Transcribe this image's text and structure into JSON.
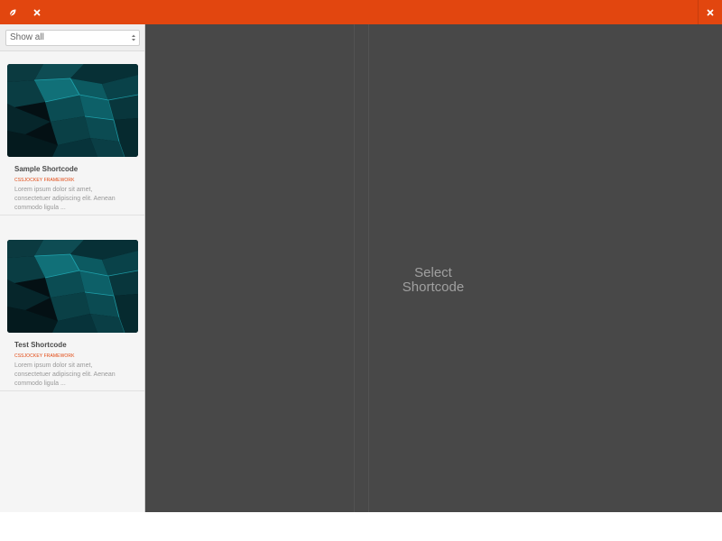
{
  "app": {
    "accent_color": "#e2460f",
    "icons": {
      "logo": "leaf-logo-icon",
      "close": "close-icon"
    }
  },
  "sidebar": {
    "filter": {
      "selected": "Show all"
    },
    "items": [
      {
        "title": "Sample Shortcode",
        "category": "CSSJOCKEY FRAMEWORK",
        "description": "Lorem ipsum dolor sit amet, consectetuer adipiscing elit. Aenean commodo ligula ..."
      },
      {
        "title": "Test Shortcode",
        "category": "CSSJOCKEY FRAMEWORK",
        "description": "Lorem ipsum dolor sit amet, consectetuer adipiscing elit. Aenean commodo ligula ..."
      }
    ]
  },
  "main": {
    "placeholder_line1": "Select",
    "placeholder_line2": "Shortcode"
  }
}
